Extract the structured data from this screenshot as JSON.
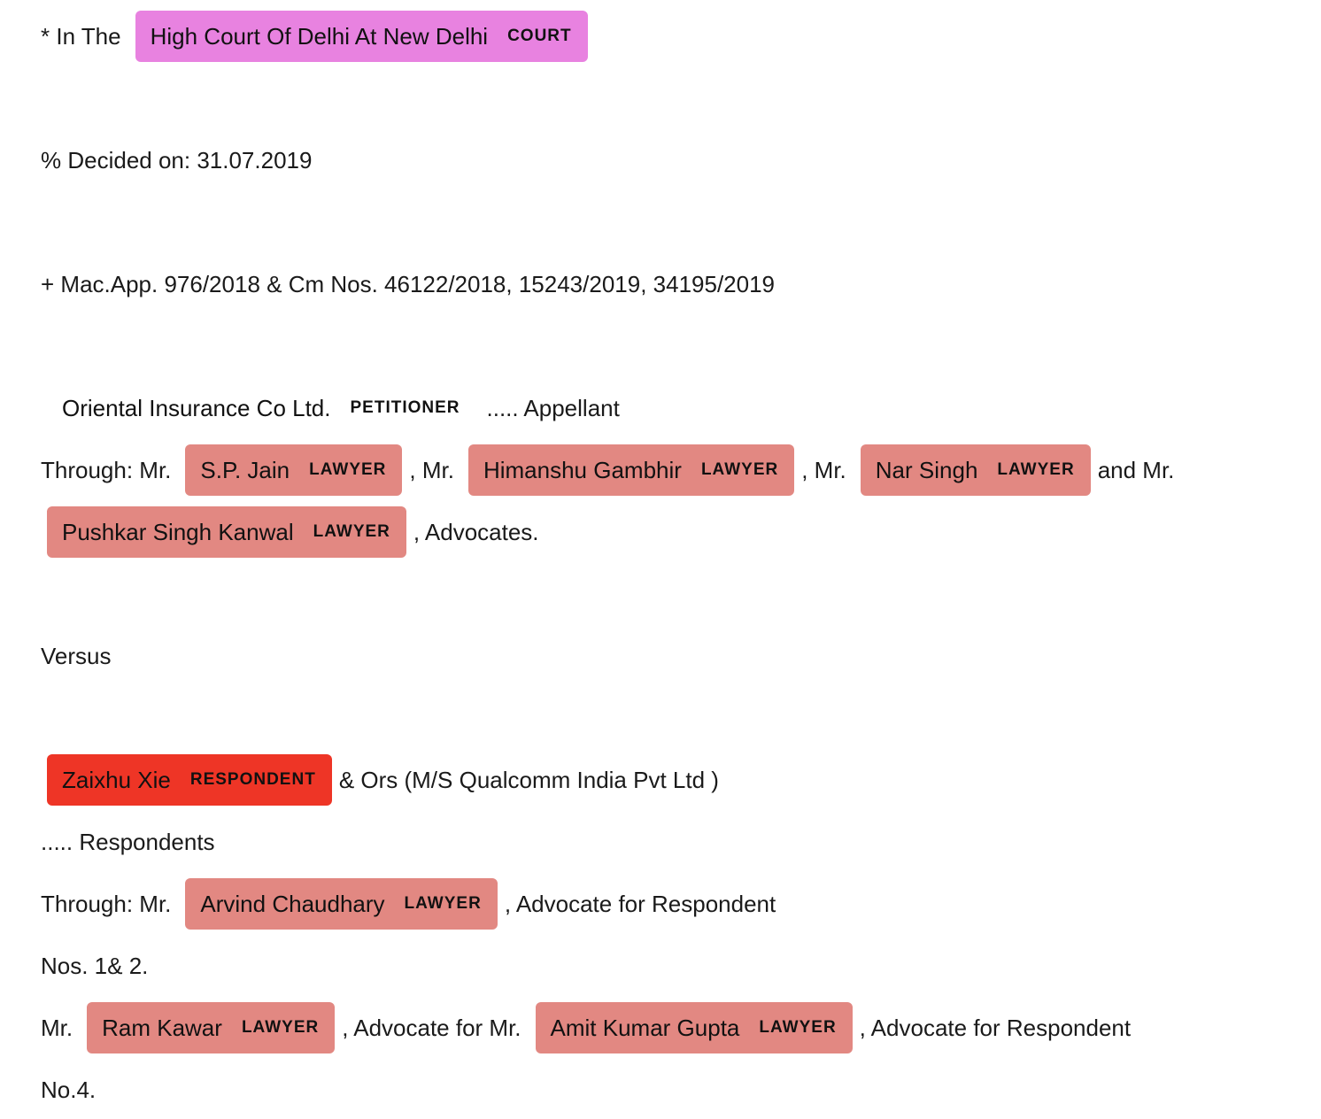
{
  "colors": {
    "court": "#e882e0",
    "lawyer": "#e28882",
    "respondent": "#ee3526",
    "petitioner": "transparent"
  },
  "lines": {
    "l1": {
      "prefix": "* In The",
      "court_name": "High Court Of Delhi At New Delhi",
      "court_tag": "COURT"
    },
    "l2": {
      "text": "% Decided on: 31.07.2019"
    },
    "l3": {
      "text": "+ Mac.App. 976/2018 & Cm Nos. 46122/2018, 15243/2019, 34195/2019"
    },
    "l4": {
      "petitioner_name": "Oriental Insurance Co Ltd.",
      "petitioner_tag": "PETITIONER",
      "suffix": "..... Appellant"
    },
    "l5": {
      "prefix": "Through: Mr.",
      "lawyer1": "S.P. Jain",
      "sep1": ", Mr.",
      "lawyer2": "Himanshu Gambhir",
      "sep2": ", Mr.",
      "lawyer3": "Nar Singh",
      "suffix": "and Mr.",
      "tag": "LAWYER"
    },
    "l6": {
      "lawyer": "Pushkar Singh Kanwal",
      "tag": "LAWYER",
      "suffix": ", Advocates."
    },
    "l7": {
      "text": "Versus"
    },
    "l8": {
      "respondent_name": "Zaixhu Xie",
      "respondent_tag": "RESPONDENT",
      "suffix": "& Ors (M/S Qualcomm India Pvt Ltd )"
    },
    "l9": {
      "text": "..... Respondents"
    },
    "l10": {
      "prefix": "Through: Mr.",
      "lawyer": "Arvind Chaudhary",
      "tag": "LAWYER",
      "suffix": ", Advocate for Respondent"
    },
    "l11": {
      "text": "Nos. 1& 2."
    },
    "l12": {
      "prefix": "Mr.",
      "lawyer1": "Ram Kawar",
      "sep": ", Advocate for Mr.",
      "lawyer2": "Amit Kumar Gupta",
      "suffix": ", Advocate for Respondent",
      "tag": "LAWYER"
    },
    "l13": {
      "text": "No.4."
    }
  }
}
